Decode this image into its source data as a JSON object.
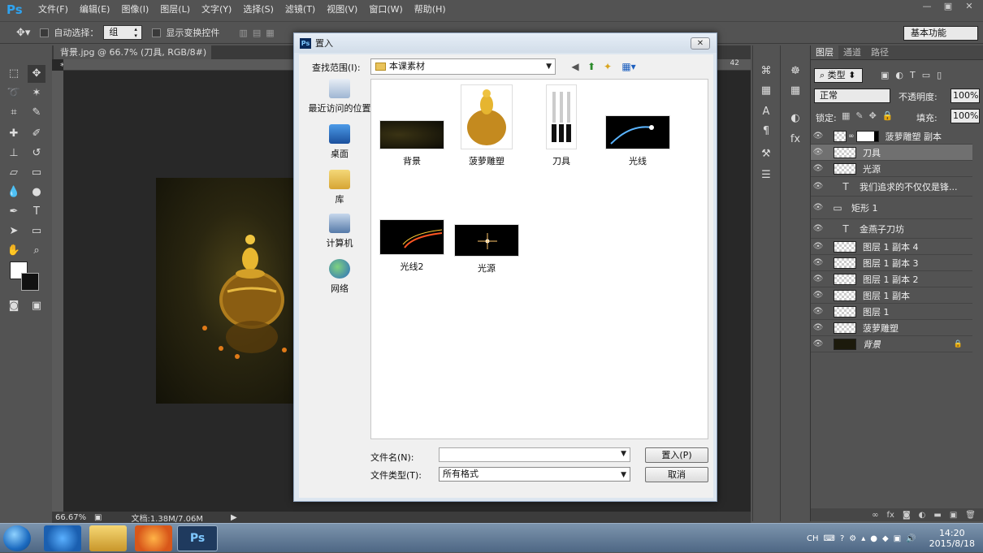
{
  "app": {
    "logo": "Ps",
    "menu": [
      "文件(F)",
      "编辑(E)",
      "图像(I)",
      "图层(L)",
      "文字(Y)",
      "选择(S)",
      "滤镜(T)",
      "视图(V)",
      "窗口(W)",
      "帮助(H)"
    ],
    "window_controls": [
      "—",
      "▣",
      "✕"
    ]
  },
  "options": {
    "auto_select_label": "自动选择：",
    "auto_select_value": "组",
    "show_transform_label": "显示变换控件",
    "workspace": "基本功能"
  },
  "document": {
    "tab_title": "背景.jpg @ 66.7% (刀具, RGB/8#) *",
    "zoom": "66.67%",
    "doc_info": "文档:1.38M/7.06M",
    "ruler_right": "42"
  },
  "layers_panel": {
    "tabs": [
      "图层",
      "通道",
      "路径"
    ],
    "filter_kind": "类型",
    "blend_mode": "正常",
    "opacity_label": "不透明度:",
    "opacity_value": "100%",
    "lock_label": "锁定:",
    "fill_label": "填充:",
    "fill_value": "100%",
    "layers": [
      {
        "name": "菠萝雕塑 副本",
        "type": "smart-mask"
      },
      {
        "name": "刀具",
        "type": "smart"
      },
      {
        "name": "光源",
        "type": "smart"
      },
      {
        "name": "我们追求的不仅仅是锋...",
        "type": "text"
      },
      {
        "name": "矩形 1",
        "type": "shape"
      },
      {
        "name": "金燕子刀坊",
        "type": "text"
      },
      {
        "name": "图层 1 副本 4",
        "type": "pixel"
      },
      {
        "name": "图层 1 副本 3",
        "type": "pixel"
      },
      {
        "name": "图层 1 副本 2",
        "type": "pixel"
      },
      {
        "name": "图层 1 副本",
        "type": "pixel"
      },
      {
        "name": "图层 1",
        "type": "pixel"
      },
      {
        "name": "菠萝雕塑",
        "type": "smart"
      },
      {
        "name": "背景",
        "type": "background"
      }
    ]
  },
  "dialog": {
    "title": "置入",
    "look_in_label": "查找范围(I):",
    "look_in_value": "本课素材",
    "places": [
      "最近访问的位置",
      "桌面",
      "库",
      "计算机",
      "网络"
    ],
    "files": [
      "背景",
      "菠萝雕塑",
      "刀具",
      "光线",
      "光线2",
      "光源"
    ],
    "filename_label": "文件名(N):",
    "filename_value": "",
    "filetype_label": "文件类型(T):",
    "filetype_value": "所有格式",
    "place_button": "置入(P)",
    "cancel_button": "取消"
  },
  "taskbar": {
    "lang": "CH",
    "time": "14:20",
    "date": "2015/8/18"
  },
  "colors": {
    "ps_blue": "#2fa3f0",
    "panel_bg": "#535353",
    "dialog_bg": "#f0f0f0",
    "selected_layer": "#707070"
  }
}
